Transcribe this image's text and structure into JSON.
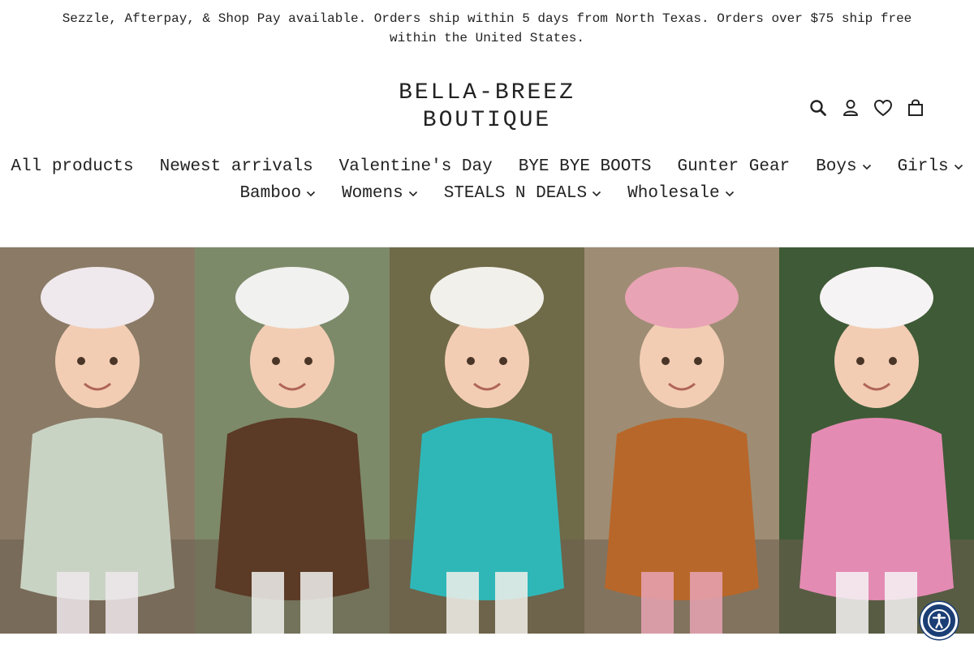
{
  "announcement": {
    "text": "Sezzle, Afterpay, & Shop Pay available. Orders ship within 5 days from North Texas. Orders over $75 ship free within the United States."
  },
  "header": {
    "logo_line1": "BELLA-BREEZ",
    "logo_line2": "BOUTIQUE",
    "icons": [
      "search-icon",
      "account-icon",
      "wishlist-heart-icon",
      "cart-icon"
    ],
    "icon_labels": {
      "search": "Search",
      "login": "Log in",
      "wishlist": "Wishlist",
      "cart": "Cart"
    }
  },
  "nav": {
    "row1": [
      {
        "label": "All products",
        "has_dropdown": false
      },
      {
        "label": "Newest arrivals",
        "has_dropdown": false
      },
      {
        "label": "Valentine's Day",
        "has_dropdown": false
      },
      {
        "label": "BYE BYE BOOTS",
        "has_dropdown": false
      },
      {
        "label": "Gunter Gear",
        "has_dropdown": false
      },
      {
        "label": "Boys",
        "has_dropdown": true
      },
      {
        "label": "Girls",
        "has_dropdown": true
      }
    ],
    "row2": [
      {
        "label": "Bamboo",
        "has_dropdown": true
      },
      {
        "label": "Womens",
        "has_dropdown": true
      },
      {
        "label": "STEALS N DEALS",
        "has_dropdown": true
      },
      {
        "label": "Wholesale",
        "has_dropdown": true
      }
    ]
  },
  "hero": {
    "panels": [
      {
        "name": "sage-romper-headbow",
        "bg": "#8a7a66",
        "outfit": "#c9d3c4",
        "accent": "#efe8ec"
      },
      {
        "name": "brown-cow-bow-bodysuit",
        "bg": "#7d8a6a",
        "outfit": "#5b3a26",
        "accent": "#f1f1ef"
      },
      {
        "name": "turquoise-western-set",
        "bg": "#6f6a48",
        "outfit": "#2fb7b8",
        "accent": "#f2f0ea"
      },
      {
        "name": "rust-ruffle-bell-bottoms",
        "bg": "#9e8d74",
        "outfit": "#b8672a",
        "accent": "#e8a3b4"
      },
      {
        "name": "pink-checkered-set",
        "bg": "#3f5a36",
        "outfit": "#e48bb3",
        "accent": "#f6f3f4"
      }
    ]
  },
  "colors": {
    "text": "#222222",
    "accessibility_button": "#1b3e75",
    "divider": "#e2e2e2"
  },
  "accessibility": {
    "icon": "accessibility-icon"
  }
}
